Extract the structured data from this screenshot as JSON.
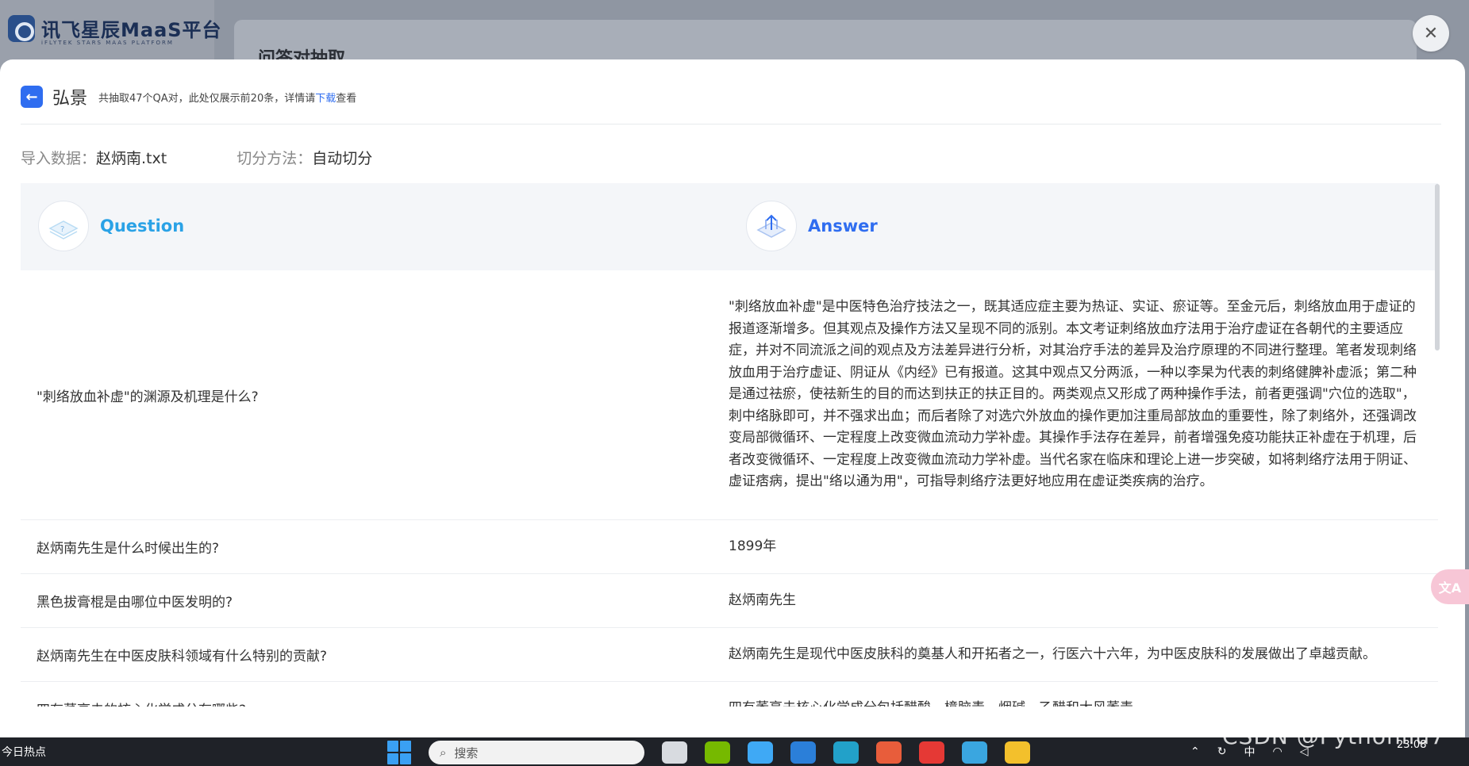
{
  "background": {
    "logo_name": "讯飞星辰MaaS平台",
    "logo_sub": "iFLYTEK STARS MAAS PLATFORM",
    "card_title": "问答对抽取"
  },
  "header": {
    "back_label": "←",
    "title": "弘景",
    "note": "共抽取47个QA对，此处仅展示前20条，详情请",
    "download_link": "下载",
    "note_suffix": "查看"
  },
  "meta": {
    "import_label": "导入数据：",
    "import_value": "赵炳南.txt",
    "split_label": "切分方法：",
    "split_value": "自动切分"
  },
  "table": {
    "question_header": "Question",
    "answer_header": "Answer",
    "rows": [
      {
        "q": "\"刺络放血补虚\"的渊源及机理是什么?",
        "a": "\"刺络放血补虚\"是中医特色治疗技法之一，既其适应症主要为热证、实证、瘀证等。至金元后，刺络放血用于虚证的报道逐渐增多。但其观点及操作方法又呈现不同的派别。本文考证刺络放血疗法用于治疗虚证在各朝代的主要适应症，并对不同流派之间的观点及方法差异进行分析，对其治疗手法的差异及治疗原理的不同进行整理。笔者发现刺络放血用于治疗虚证、阴证从《内经》已有报道。这其中观点又分两派，一种以李杲为代表的刺络健脾补虚派；第二种是通过祛瘀，使祛新生的目的而达到扶正的扶正目的。两类观点又形成了两种操作手法，前者更强调\"穴位的选取\"，刺中络脉即可，并不强求出血；而后者除了对选穴外放血的操作更加注重局部放血的重要性，除了刺络外，还强调改变局部微循环、一定程度上改变微血流动力学补虚。其操作手法存在差异，前者增强免疫功能扶正补虚在于机理，后者改变微循环、一定程度上改变微血流动力学补虚。当代名家在临床和理论上进一步突破，如将刺络疗法用于阴证、虚证痞病，提出\"络以通为用\"，可指导刺络疗法更好地应用在虚证类疾病的治疗。"
      },
      {
        "q": "赵炳南先生是什么时候出生的?",
        "a": "1899年"
      },
      {
        "q": "黑色拔膏棍是由哪位中医发明的?",
        "a": "赵炳南先生"
      },
      {
        "q": "赵炳南先生在中医皮肤科领域有什么特别的贡献?",
        "a": "赵炳南先生是现代中医皮肤科的奠基人和开拓者之一，行医六十六年，为中医皮肤科的发展做出了卓越贡献。"
      },
      {
        "q": "四有莠亭去的核心化学成分有哪些?",
        "a": "四有莠亭去核心化学成分包括醋酸、樟脑毒、烟碱、乙醋和大风莠毒"
      }
    ]
  },
  "side": {
    "translate_label": "文A"
  },
  "taskbar": {
    "news": "今日热点",
    "search_placeholder": "搜索",
    "tray_lang": "中",
    "time": "23:08",
    "watermark": "CSDN @Pythonliu7"
  },
  "colors": {
    "accent": "#2f6df0",
    "question": "#2aa2e6"
  }
}
